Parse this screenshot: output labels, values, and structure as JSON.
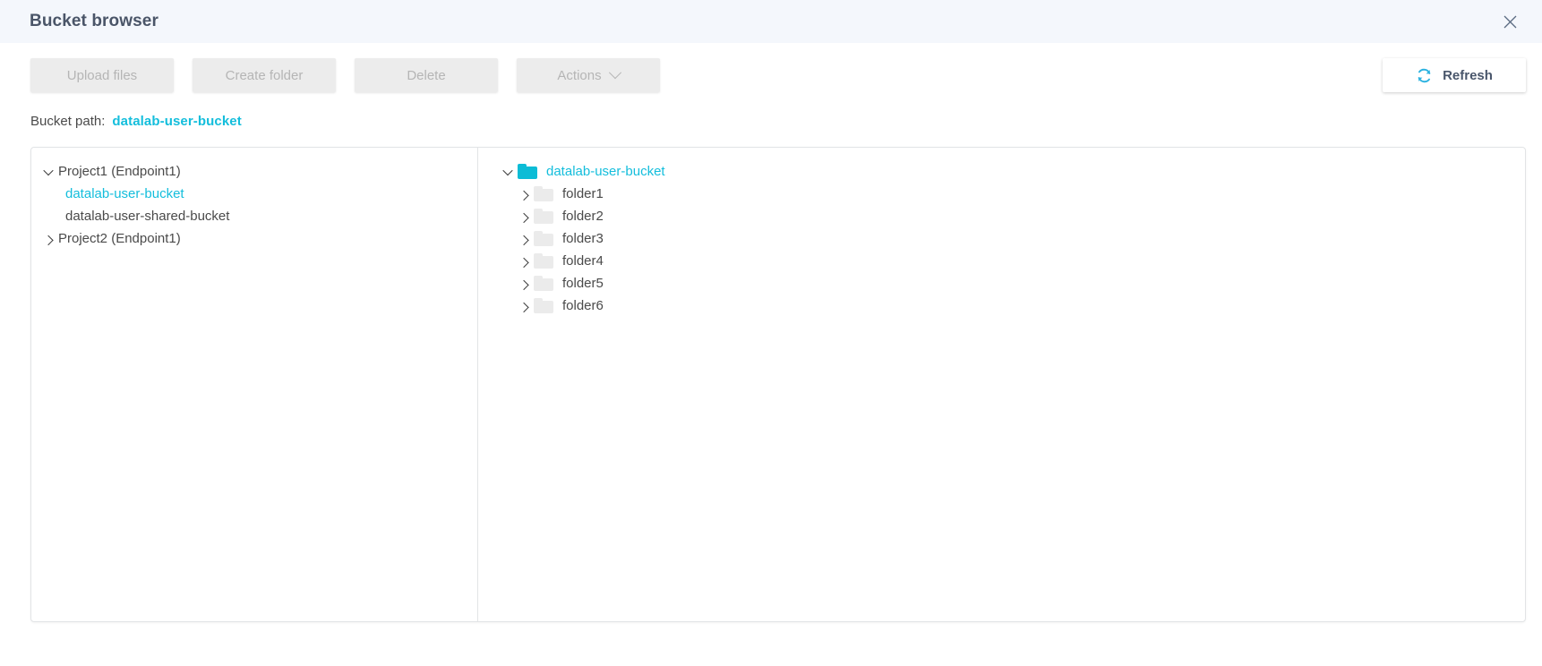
{
  "header": {
    "title": "Bucket browser",
    "close_icon": "close-icon"
  },
  "toolbar": {
    "upload_files_label": "Upload files",
    "create_folder_label": "Create folder",
    "delete_label": "Delete",
    "actions_label": "Actions",
    "actions_chevron_icon": "chevron-down-icon",
    "refresh_label": "Refresh",
    "refresh_icon": "refresh-icon"
  },
  "bucket_path": {
    "label": "Bucket path:",
    "value": "datalab-user-bucket"
  },
  "projects_tree": [
    {
      "label": "Project1 (Endpoint1)",
      "expanded": true,
      "buckets": [
        {
          "label": "datalab-user-bucket",
          "selected": true
        },
        {
          "label": "datalab-user-shared-bucket",
          "selected": false
        }
      ]
    },
    {
      "label": "Project2 (Endpoint1)",
      "expanded": false,
      "buckets": []
    }
  ],
  "bucket_tree": {
    "root": {
      "label": "datalab-user-bucket",
      "expanded": true,
      "folder_icon": "folder-icon-cyan"
    },
    "folders": [
      {
        "label": "folder1",
        "expanded": false,
        "folder_icon": "folder-icon-grey"
      },
      {
        "label": "folder2",
        "expanded": false,
        "folder_icon": "folder-icon-grey"
      },
      {
        "label": "folder3",
        "expanded": false,
        "folder_icon": "folder-icon-grey"
      },
      {
        "label": "folder4",
        "expanded": false,
        "folder_icon": "folder-icon-grey"
      },
      {
        "label": "folder5",
        "expanded": false,
        "folder_icon": "folder-icon-grey"
      },
      {
        "label": "folder6",
        "expanded": false,
        "folder_icon": "folder-icon-grey"
      }
    ]
  },
  "colors": {
    "accent": "#14bedc",
    "folder_cyan": "#0cbcd6",
    "header_bg": "#f4f7fc",
    "text": "#4a4a4a"
  }
}
